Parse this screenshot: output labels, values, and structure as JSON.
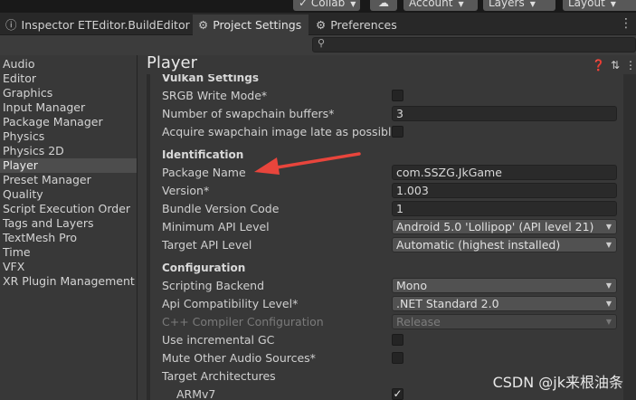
{
  "toolbar": {
    "collab": "Collab",
    "account": "Account",
    "layers": "Layers",
    "layout": "Layout"
  },
  "tabs": [
    {
      "label": "Inspector"
    },
    {
      "label": "ETEditor.BuildEditor"
    },
    {
      "label": "Project Settings"
    },
    {
      "label": "Preferences"
    }
  ],
  "search": {
    "value": "",
    "placeholder": ""
  },
  "sidebar": {
    "items": [
      "Audio",
      "Editor",
      "Graphics",
      "Input Manager",
      "Package Manager",
      "Physics",
      "Physics 2D",
      "Player",
      "Preset Manager",
      "Quality",
      "Script Execution Order",
      "Tags and Layers",
      "TextMesh Pro",
      "Time",
      "VFX",
      "XR Plugin Management"
    ],
    "selected": "Player"
  },
  "main": {
    "title": "Player",
    "vulkan": {
      "header": "Vulkan Settings",
      "srgb": "SRGB Write Mode*",
      "swapchain": "Number of swapchain buffers*",
      "swapchain_value": "3",
      "acquire": "Acquire swapchain image late as possible*"
    },
    "identification": {
      "header": "Identification",
      "package_label": "Package Name",
      "package_value": "com.SSZG.JkGame",
      "version_label": "Version*",
      "version_value": "1.003",
      "bundle_label": "Bundle Version Code",
      "bundle_value": "1",
      "min_api_label": "Minimum API Level",
      "min_api_value": "Android 5.0 'Lollipop' (API level 21)",
      "target_api_label": "Target API Level",
      "target_api_value": "Automatic (highest installed)"
    },
    "configuration": {
      "header": "Configuration",
      "scripting_label": "Scripting Backend",
      "scripting_value": "Mono",
      "api_compat_label": "Api Compatibility Level*",
      "api_compat_value": ".NET Standard 2.0",
      "cpp_label": "C++ Compiler Configuration",
      "cpp_value": "Release",
      "incremental_label": "Use incremental GC",
      "mute_label": "Mute Other Audio Sources*",
      "target_arch_label": "Target Architectures",
      "armv7_label": "ARMv7"
    }
  },
  "watermark": "CSDN @jk来根油条",
  "colors": {
    "annotation_arrow": "#e8453c",
    "selected_bg": "#4d4d4d"
  }
}
